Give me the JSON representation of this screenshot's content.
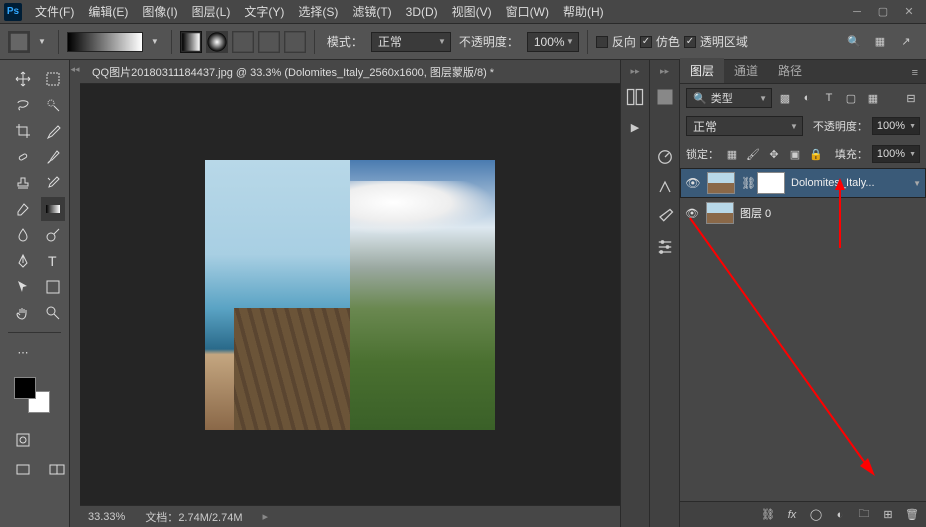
{
  "menu": [
    "文件(F)",
    "编辑(E)",
    "图像(I)",
    "图层(L)",
    "文字(Y)",
    "选择(S)",
    "滤镜(T)",
    "3D(D)",
    "视图(V)",
    "窗口(W)",
    "帮助(H)"
  ],
  "toolbar": {
    "mode_label": "模式：",
    "mode_value": "正常",
    "opacity_label": "不透明度：",
    "opacity_value": "100%",
    "reverse": "反向",
    "dither": "仿色",
    "transparency": "透明区域"
  },
  "doc": {
    "tab_title": "QQ图片20180311184437.jpg @ 33.3% (Dolomites_Italy_2560x1600, 图层蒙版/8) *",
    "zoom": "33.33%",
    "doc_label": "文档：",
    "doc_value": "2.74M/2.74M"
  },
  "panels": {
    "tabs": [
      "图层",
      "通道",
      "路径"
    ],
    "filter_label": "类型",
    "blend_mode": "正常",
    "opacity_label": "不透明度：",
    "opacity_value": "100%",
    "lock_label": "锁定：",
    "fill_label": "填充：",
    "fill_value": "100%",
    "layers": [
      {
        "name": "Dolomites_Italy...",
        "selected": true,
        "hasMask": true
      },
      {
        "name": "图层 0",
        "selected": false,
        "hasMask": false
      }
    ]
  }
}
